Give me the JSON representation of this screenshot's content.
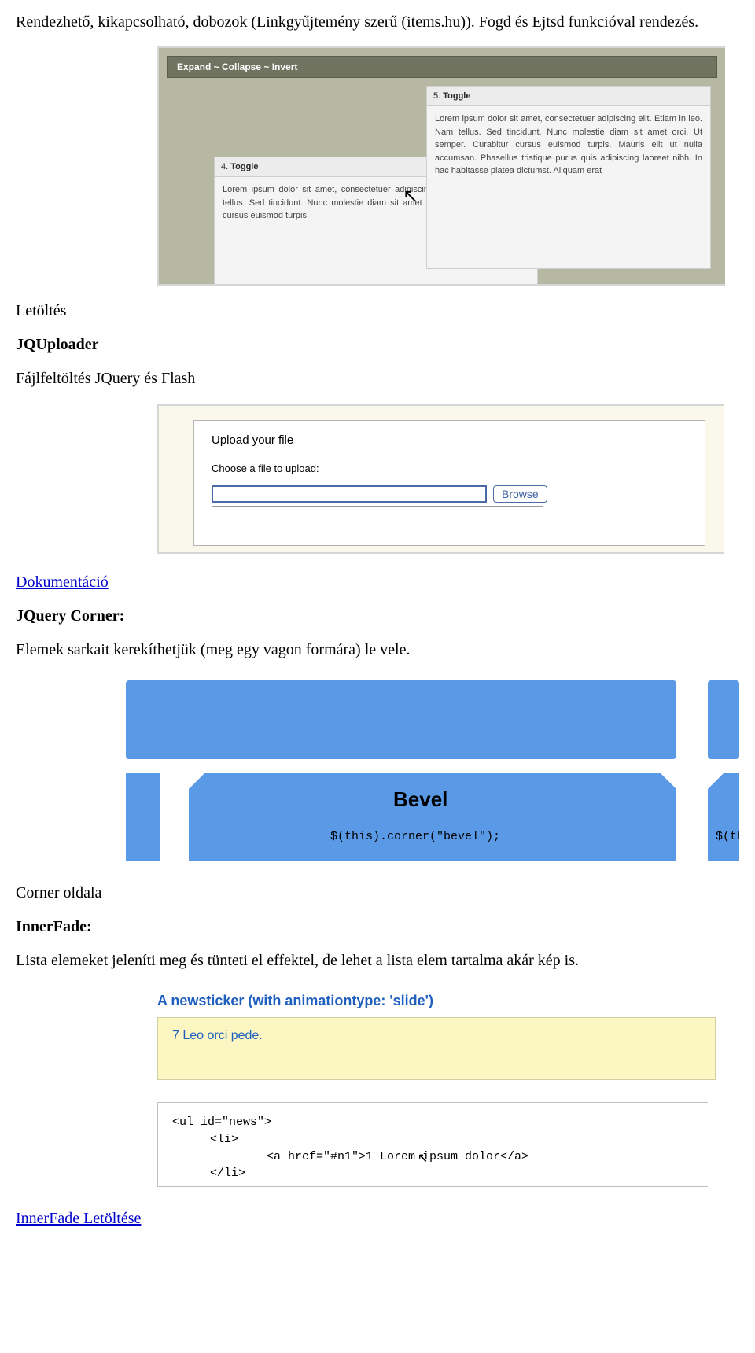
{
  "intro": "Rendezhető, kikapcsolható, dobozok (Linkgyűjtemény szerű (items.hu)). Fogd és Ejtsd funkcióval rendezés.",
  "fig1": {
    "toolbar": "Expand ~ Collapse ~ Invert",
    "panel4": {
      "head_num": "4.",
      "head_label": "Toggle",
      "body": "Lorem ipsum dolor sit amet, consectetuer adipiscing elit. Etiam in leo. Nam tellus. Sed tincidunt. Nunc molestie diam sit amet orci. Ut semper. Curabitur cursus euismod turpis."
    },
    "panel5": {
      "head_num": "5.",
      "head_label": "Toggle",
      "body": "Lorem ipsum dolor sit amet, consectetuer adipiscing elit. Etiam in leo. Nam tellus. Sed tincidunt. Nunc molestie diam sit amet orci. Ut semper. Curabitur cursus euismod turpis. Mauris elit ut nulla accumsan. Phasellus tristique purus quis adipiscing laoreet nibh. In hac habitasse platea dictumst. Aliquam erat"
    }
  },
  "after1": {
    "download": "Letöltés",
    "title2": "JQUploader",
    "desc2": "Fájlfeltöltés JQuery és Flash"
  },
  "fig2": {
    "title": "Upload your file",
    "choose": "Choose a file to upload:",
    "browse": "Browse"
  },
  "links": {
    "doc": "Dokumentáció",
    "corner_title": "JQuery Corner:",
    "corner_desc": "Elemek sarkait kerekíthetjük (meg egy vagon formára) le vele."
  },
  "fig3": {
    "label": "Bevel",
    "code1": "$(this).corner(\"bevel\");",
    "code2": "$(this)"
  },
  "after3": {
    "corner_page": "Corner oldala",
    "innerfade_title": "InnerFade:",
    "innerfade_desc": "Lista elemeket jeleníti meg és tünteti el effektel, de lehet a lista elem tartalma akár kép is."
  },
  "fig4": {
    "title": "A newsticker (with animationtype: 'slide')",
    "ticker_item": "7 Leo orci pede.",
    "code": {
      "l1": "<ul id=\"news\">",
      "l2": "<li>",
      "l3": "<a href=\"#n1\">1 Lorem ipsum dolor</a>",
      "l4": "</li>"
    }
  },
  "footer_link": "InnerFade Letöltése"
}
